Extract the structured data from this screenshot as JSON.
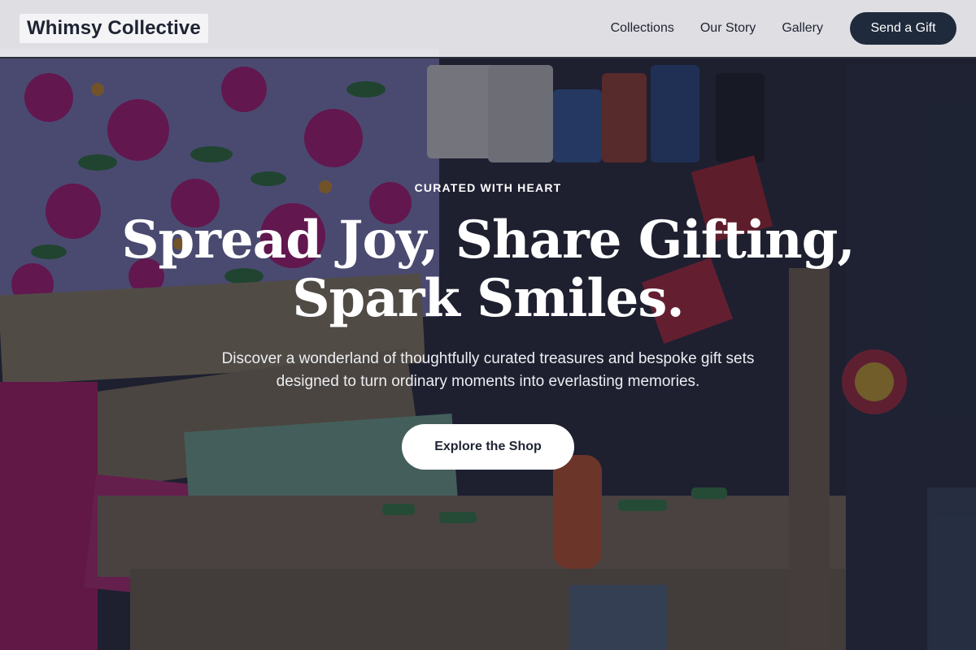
{
  "header": {
    "logo": "Whimsy Collective",
    "nav": [
      "Collections",
      "Our Story",
      "Gallery"
    ],
    "cta_label": "Send a Gift"
  },
  "hero": {
    "eyebrow": "CURATED WITH HEART",
    "headline_line1": "Spread Joy, Share Gifting,",
    "headline_line2": "Spark Smiles.",
    "subtext": "Discover a wonderland of thoughtfully curated treasures and bespoke gift sets designed to turn ordinary moments into everlasting memories.",
    "cta_label": "Explore the Shop"
  },
  "colors": {
    "header_bg": "#f0f0f3",
    "primary_button": "#1f2a3d",
    "text_dark": "#1f2433",
    "hero_overlay": "#141828"
  }
}
